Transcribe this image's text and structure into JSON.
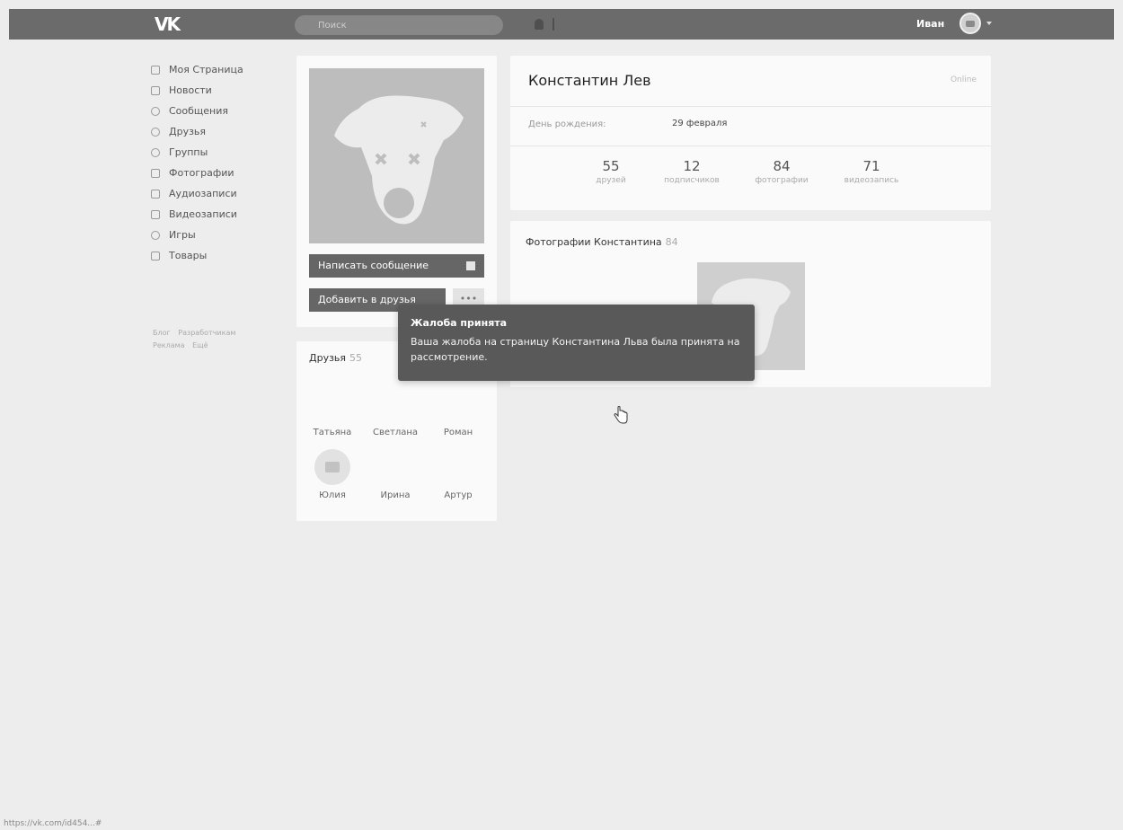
{
  "header": {
    "search_placeholder": "Поиск",
    "user_name": "Иван"
  },
  "left_nav": {
    "items": [
      {
        "label": "Моя Страница",
        "icon": "home-icon"
      },
      {
        "label": "Новости",
        "icon": "news-icon"
      },
      {
        "label": "Сообщения",
        "icon": "messages-icon"
      },
      {
        "label": "Друзья",
        "icon": "friends-icon"
      },
      {
        "label": "Группы",
        "icon": "groups-icon"
      },
      {
        "label": "Фотографии",
        "icon": "photos-icon"
      },
      {
        "label": "Аудиозаписи",
        "icon": "music-icon"
      },
      {
        "label": "Видеозаписи",
        "icon": "video-icon"
      },
      {
        "label": "Игры",
        "icon": "games-icon"
      },
      {
        "label": "Товары",
        "icon": "goods-icon"
      }
    ],
    "footer": [
      "Блог",
      "Разработчикам",
      "Реклама",
      "Ещё"
    ]
  },
  "profile": {
    "message_button": "Написать сообщение",
    "add_friend_button": "Добавить в друзья",
    "more_button": "•••"
  },
  "friends": {
    "title": "Друзья",
    "count": "55",
    "items": [
      {
        "name": "Татьяна",
        "has_photo": false
      },
      {
        "name": "Светлана",
        "has_photo": false
      },
      {
        "name": "Роман",
        "has_photo": false
      },
      {
        "name": "Юлия",
        "has_photo": true
      },
      {
        "name": "Ирина",
        "has_photo": false
      },
      {
        "name": "Артур",
        "has_photo": false
      }
    ]
  },
  "info": {
    "name": "Константин Лев",
    "status": "Online",
    "birthday_label": "День рождения:",
    "birthday_value": "29 февраля",
    "stats": [
      {
        "value": "55",
        "label": "друзей"
      },
      {
        "value": "12",
        "label": "подписчиков"
      },
      {
        "value": "84",
        "label": "фотографии"
      },
      {
        "value": "71",
        "label": "видеозапись"
      }
    ]
  },
  "photos": {
    "title": "Фотографии Константина",
    "count": "84"
  },
  "toast": {
    "title": "Жалоба принята",
    "text": "Ваша жалоба на страницу Константина Льва была принята на рассмотрение."
  },
  "statusbar": {
    "url": "https://vk.com/id454...#"
  }
}
